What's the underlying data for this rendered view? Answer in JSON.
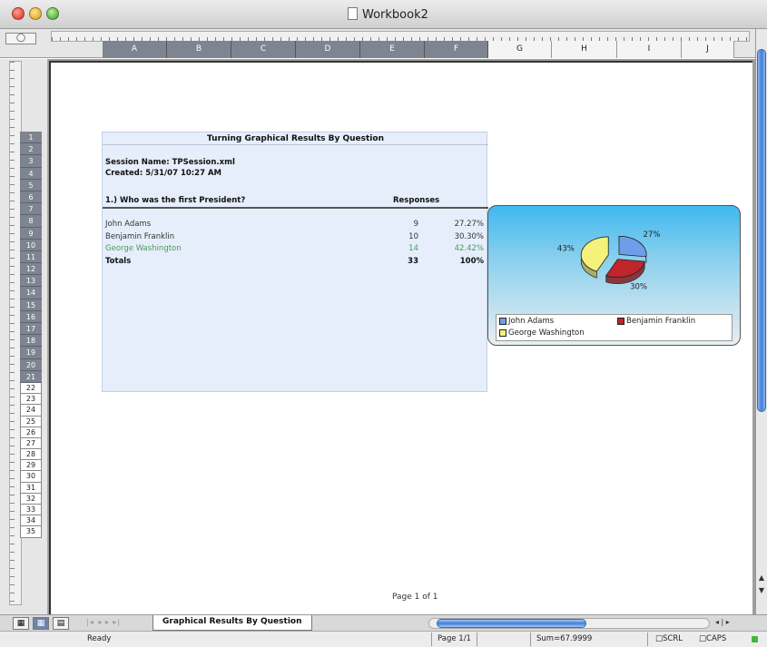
{
  "window": {
    "title": "Workbook2"
  },
  "columns": [
    {
      "label": "A",
      "w": 71,
      "sel": true
    },
    {
      "label": "B",
      "w": 71,
      "sel": true
    },
    {
      "label": "C",
      "w": 71,
      "sel": true
    },
    {
      "label": "D",
      "w": 71,
      "sel": true
    },
    {
      "label": "E",
      "w": 71,
      "sel": true
    },
    {
      "label": "F",
      "w": 70,
      "sel": true
    },
    {
      "label": "G",
      "w": 70,
      "sel": false
    },
    {
      "label": "H",
      "w": 72,
      "sel": false
    },
    {
      "label": "I",
      "w": 71,
      "sel": false
    },
    {
      "label": "J",
      "w": 58,
      "sel": false
    }
  ],
  "rows": [
    "1",
    "2",
    "3",
    "4",
    "5",
    "6",
    "7",
    "8",
    "9",
    "10",
    "11",
    "12",
    "13",
    "14",
    "15",
    "16",
    "17",
    "18",
    "19",
    "20",
    "21",
    "22",
    "23",
    "24",
    "25",
    "26",
    "27",
    "28",
    "29",
    "30",
    "31",
    "32",
    "33",
    "34",
    "35"
  ],
  "report": {
    "title": "Turning Graphical Results By Question",
    "session": "Session Name: TPSession.xml",
    "created": "Created: 5/31/07 10:27 AM",
    "question": "1.) Who was the first President?",
    "responses_label": "Responses",
    "answers": [
      {
        "label": "John Adams",
        "count": "9",
        "pct": "27.27%"
      },
      {
        "label": "Benjamin Franklin",
        "count": "10",
        "pct": "30.30%"
      },
      {
        "label": "George Washington",
        "count": "14",
        "pct": "42.42%"
      }
    ],
    "totals": {
      "label": "Totals",
      "count": "33",
      "pct": "100%"
    }
  },
  "chart_data": {
    "type": "pie",
    "categories": [
      "John Adams",
      "Benjamin Franklin",
      "George Washington"
    ],
    "values": [
      27,
      30,
      43
    ],
    "data_labels": [
      "27%",
      "30%",
      "43%"
    ],
    "colors": [
      "#6f9ee8",
      "#c0252c",
      "#f6f17a"
    ],
    "legend_position": "bottom"
  },
  "page_number": "Page 1 of 1",
  "sheet_tab": "Graphical Results By Question",
  "status": {
    "ready": "Ready",
    "page": "Page 1/1",
    "sum": "Sum=67.9999",
    "scrl": "SCRL",
    "caps": "CAPS"
  }
}
